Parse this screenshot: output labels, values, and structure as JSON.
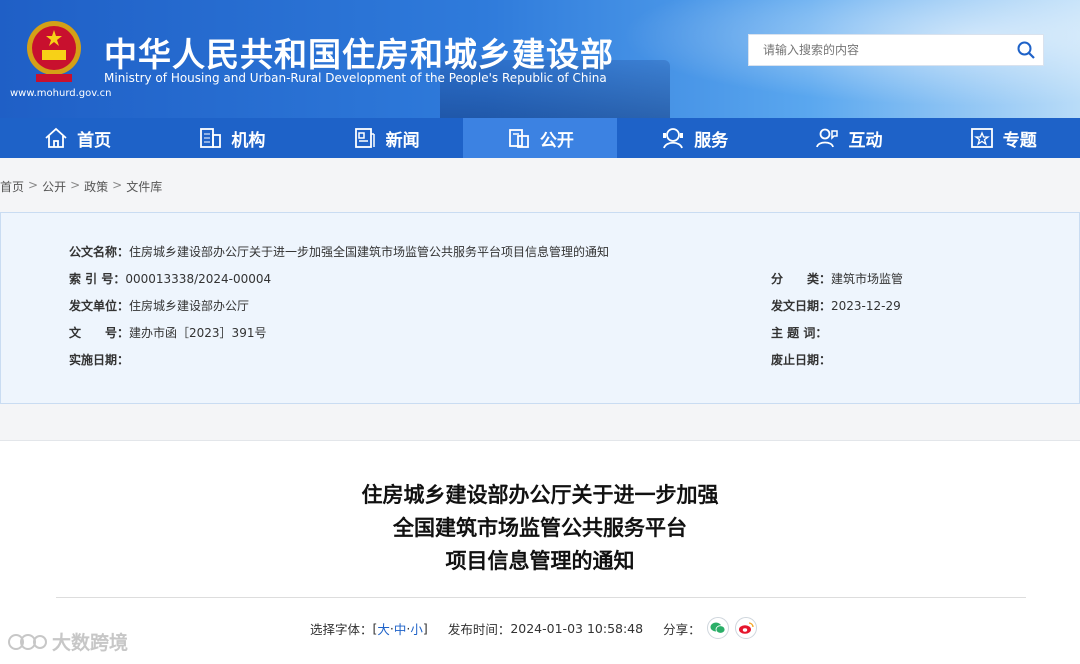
{
  "header": {
    "title_cn": "中华人民共和国住房和城乡建设部",
    "title_en": "Ministry of Housing and Urban-Rural Development of the People's Republic of China",
    "site_url": "www.mohurd.gov.cn",
    "search_placeholder": "请输入搜索的内容"
  },
  "nav": [
    {
      "label": "首页",
      "icon": "home-icon"
    },
    {
      "label": "机构",
      "icon": "building-icon"
    },
    {
      "label": "新闻",
      "icon": "news-icon"
    },
    {
      "label": "公开",
      "icon": "document-icon",
      "active": true
    },
    {
      "label": "服务",
      "icon": "service-icon"
    },
    {
      "label": "互动",
      "icon": "interaction-icon"
    },
    {
      "label": "专题",
      "icon": "topic-icon"
    }
  ],
  "breadcrumb": [
    "首页",
    "公开",
    "政策",
    "文件库"
  ],
  "meta": {
    "name_label": "公文名称：",
    "name_value": "住房城乡建设部办公厅关于进一步加强全国建筑市场监管公共服务平台项目信息管理的通知",
    "index_label": "索 引 号：",
    "index_value": "000013338/2024-00004",
    "category_label": "分　　类：",
    "category_value": "建筑市场监管",
    "issuer_label": "发文单位：",
    "issuer_value": "住房城乡建设部办公厅",
    "issue_date_label": "发文日期：",
    "issue_date_value": "2023-12-29",
    "docno_label": "文　　号：",
    "docno_value": "建办市函［2023］391号",
    "keywords_label": "主 题 词：",
    "keywords_value": "",
    "effective_label": "实施日期：",
    "effective_value": "",
    "repeal_label": "废止日期：",
    "repeal_value": ""
  },
  "article": {
    "title_line1": "住房城乡建设部办公厅关于进一步加强",
    "title_line2": "全国建筑市场监管公共服务平台",
    "title_line3": "项目信息管理的通知",
    "font_label": "选择字体：",
    "font_open": "[",
    "font_large": "大",
    "font_dot1": "·",
    "font_medium": "中",
    "font_dot2": "·",
    "font_small": "小",
    "font_close": "]",
    "publish_label": "发布时间：",
    "publish_time": "2024-01-03 10:58:48",
    "share_label": "分享："
  },
  "watermark": "大数跨境",
  "colors": {
    "nav_bg": "#1e62c8",
    "nav_active": "#3c82e2",
    "meta_bg": "#eef5fd"
  }
}
